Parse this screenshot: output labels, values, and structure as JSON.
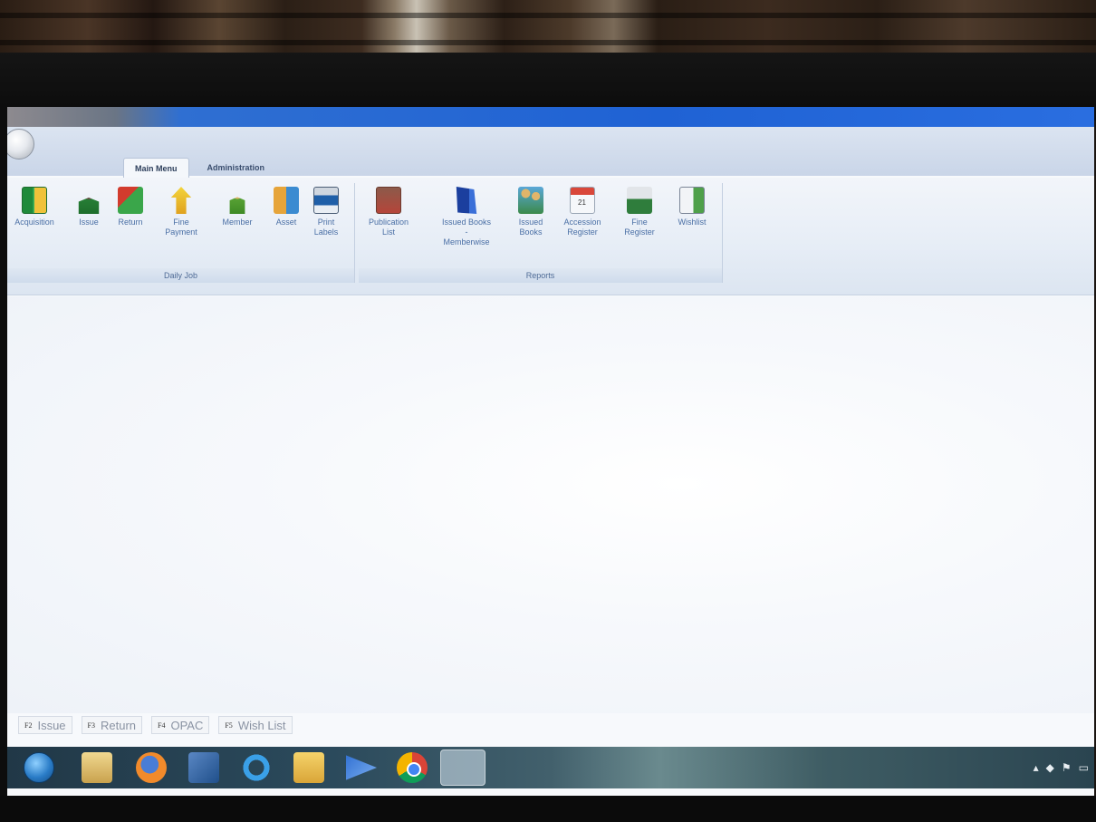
{
  "tabs": [
    {
      "label": "Main Menu",
      "active": true
    },
    {
      "label": "Administration",
      "active": false
    }
  ],
  "ribbon": {
    "daily_job": {
      "label": "Daily Job",
      "buttons": [
        {
          "label": "Acquisition",
          "icon": "books-icon"
        },
        {
          "label": "Issue",
          "icon": "person-book-icon"
        },
        {
          "label": "Return",
          "icon": "return-arrows-icon"
        },
        {
          "label": "Fine\nPayment",
          "icon": "fine-payment-icon"
        },
        {
          "label": "Member",
          "icon": "member-icon"
        },
        {
          "label": "Asset",
          "icon": "asset-icon"
        },
        {
          "label": "Print\nLabels",
          "icon": "printer-icon"
        }
      ]
    },
    "reports": {
      "label": "Reports",
      "buttons": [
        {
          "label": "Publication\nList",
          "icon": "publication-list-icon"
        },
        {
          "label": "Issued Books\n-\nMemberwise",
          "icon": "issued-books-memberwise-icon"
        },
        {
          "label": "Issued\nBooks",
          "icon": "issued-books-icon"
        },
        {
          "label": "Accession\nRegister",
          "icon": "calendar-icon"
        },
        {
          "label": "Fine\nRegister",
          "icon": "fine-register-icon"
        },
        {
          "label": "Wishlist",
          "icon": "wishlist-icon"
        }
      ]
    }
  },
  "hotkeys": [
    {
      "key": "F2",
      "label": "Issue"
    },
    {
      "key": "F3",
      "label": "Return"
    },
    {
      "key": "F4",
      "label": "OPAC"
    },
    {
      "key": "F5",
      "label": "Wish List"
    }
  ],
  "taskbar": {
    "items": [
      "start-button",
      "file-explorer-icon",
      "firefox-icon",
      "media-icon",
      "internet-explorer-icon",
      "folder-icon",
      "arrow-app-icon",
      "chrome-icon",
      "library-app-icon"
    ],
    "tray": [
      "chevron-up-icon",
      "network-icon",
      "flag-icon",
      "monitor-icon"
    ]
  },
  "colors": {
    "ribbon_label": "#4a6fa5",
    "taskbar": "#2b4a5c",
    "accent": "#1f62d4"
  }
}
